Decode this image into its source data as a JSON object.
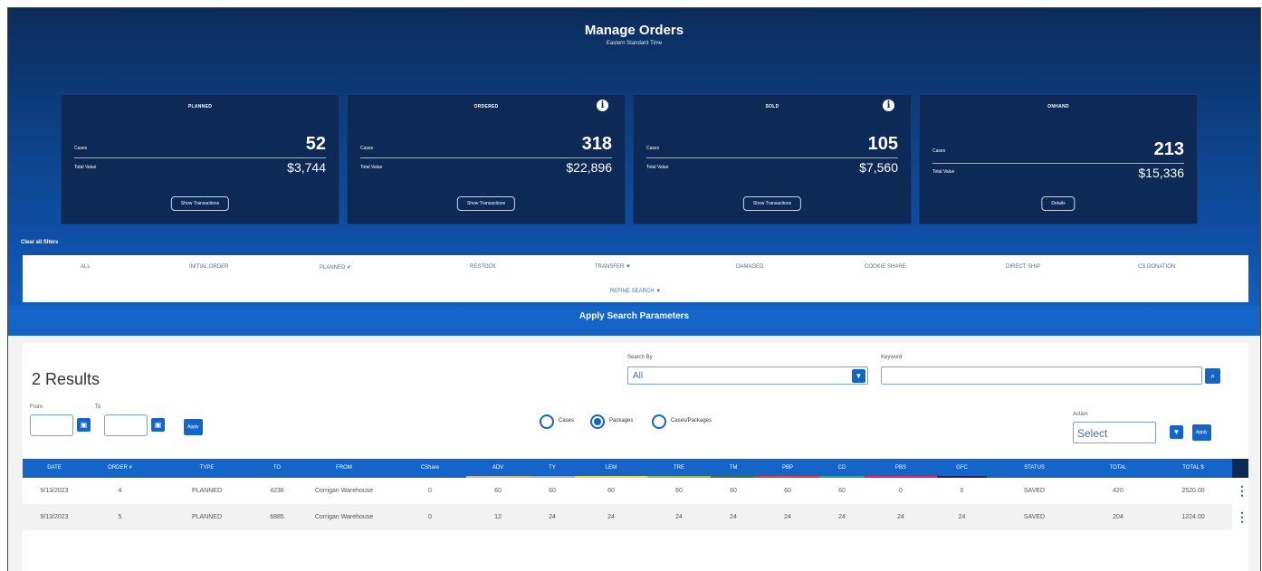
{
  "header": {
    "title": "Manage Orders",
    "subtitle": "Eastern Standard Time"
  },
  "cards": [
    {
      "title": "PLANNED",
      "cases_label": "Cases",
      "cases": "52",
      "value_label": "Total Value",
      "value": "$3,744",
      "button": "Show Transactions",
      "info": false
    },
    {
      "title": "ORDERED",
      "cases_label": "Cases",
      "cases": "318",
      "value_label": "Total Value",
      "value": "$22,896",
      "button": "Show Transactions",
      "info": true
    },
    {
      "title": "SOLD",
      "cases_label": "Cases",
      "cases": "105",
      "value_label": "Total Value",
      "value": "$7,560",
      "button": "Show Transactions",
      "info": true
    },
    {
      "title": "ONHAND",
      "cases_label": "Cases",
      "cases": "213",
      "value_label": "Total Value",
      "value": "$15,336",
      "button": "Details",
      "info": false
    }
  ],
  "filters": {
    "clear_label": "Clear all filters",
    "items": [
      "ALL",
      "INITIAL ORDER",
      "PLANNED ✔",
      "RESTOCK",
      "TRANSFER ▼",
      "DAMAGED",
      "COOKIE SHARE",
      "DIRECT SHIP",
      "CS DONATION"
    ],
    "refine_label": "REFINE SEARCH ▼",
    "apply_label": "Apply Search Parameters"
  },
  "results": {
    "count_label": "2 Results"
  },
  "search": {
    "by_label": "Search By",
    "by_value": "All",
    "keyword_label": "Keyword",
    "keyword_value": ""
  },
  "date_range": {
    "from_label": "From",
    "to_label": "To",
    "apply_label": "Apply"
  },
  "units": {
    "options": [
      "Cases",
      "Packages",
      "Cases/Packages"
    ],
    "selected": "Packages"
  },
  "action": {
    "label": "Action",
    "value": "Select",
    "apply_label": "Apply"
  },
  "table": {
    "columns": [
      "DATE",
      "ORDER #",
      "TYPE",
      "TO",
      "FROM",
      "CShare",
      "ADV",
      "TY",
      "LEM",
      "TRE",
      "TM",
      "PBP",
      "CD",
      "PBS",
      "GFC",
      "STATUS",
      "TOTAL",
      "TOTAL $"
    ],
    "column_colors": {
      "ADV": "#c9b98a",
      "TY": "#8ab4e0",
      "LEM": "#e7d94a",
      "TRE": "#8bc34a",
      "TM": "#2e7d32",
      "PBP": "#e53935",
      "CD": "#26a69a",
      "PBS": "#e91e63",
      "GFC": "#1a237e"
    },
    "rows": [
      [
        "9/13/2023",
        "4",
        "PLANNED",
        "4236",
        "Corrigan Warehouse",
        "0",
        "60",
        "60",
        "60",
        "60",
        "60",
        "60",
        "60",
        "0",
        "0",
        "SAVED",
        "420",
        "2520.00"
      ],
      [
        "9/13/2023",
        "5",
        "PLANNED",
        "6885",
        "Corrigan Warehouse",
        "0",
        "12",
        "24",
        "24",
        "24",
        "24",
        "24",
        "24",
        "24",
        "24",
        "SAVED",
        "204",
        "1224.00"
      ]
    ]
  },
  "colors": {
    "accent": "#1565c9",
    "hero_dark": "#0b2c5a",
    "card_bg": "#0c2a55"
  }
}
